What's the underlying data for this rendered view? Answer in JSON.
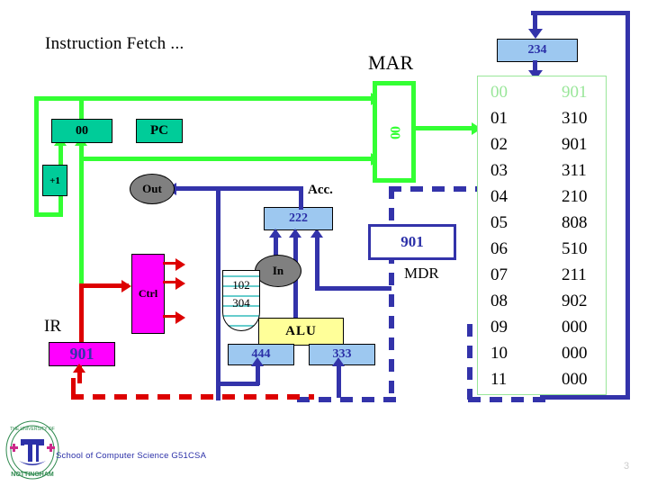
{
  "slide": {
    "title": "Instruction Fetch  ...",
    "page_number": "3",
    "footer": "School of Computer Science G51CSA",
    "logo_name": "university-of-nottingham-crest"
  },
  "colors": {
    "address_bus_green": "#33ff33",
    "register_green": "#00cc99",
    "data_bus_blue": "#3333aa",
    "data_box_blue": "#9dc8f0",
    "control_magenta": "#ff00ff",
    "control_red": "#dd0000",
    "alu_yellow": "#ffff99",
    "memory_highlight_green": "#99e699",
    "io_gray": "#808080"
  },
  "cpu": {
    "pc": {
      "label": "PC",
      "value": "00"
    },
    "incrementer": {
      "label": "+1"
    },
    "mar": {
      "label": "MAR",
      "value": "00"
    },
    "mdr": {
      "label": "MDR",
      "value": "901"
    },
    "accumulator": {
      "label": "Acc.",
      "value": "222"
    },
    "ir": {
      "label": "IR",
      "value": "901"
    },
    "control_unit": {
      "label": "Ctrl"
    },
    "alu": {
      "label": "ALU",
      "left_value": "444",
      "right_value": "333"
    },
    "bus_value": "234"
  },
  "io": {
    "out": {
      "label": "Out"
    },
    "in": {
      "label": "In"
    },
    "input_paper": {
      "lines": [
        "102",
        "304"
      ]
    }
  },
  "memory": {
    "rows": [
      {
        "address": "00",
        "value": "901",
        "highlighted": true
      },
      {
        "address": "01",
        "value": "310",
        "highlighted": false
      },
      {
        "address": "02",
        "value": "901",
        "highlighted": false
      },
      {
        "address": "03",
        "value": "311",
        "highlighted": false
      },
      {
        "address": "04",
        "value": "210",
        "highlighted": false
      },
      {
        "address": "05",
        "value": "808",
        "highlighted": false
      },
      {
        "address": "06",
        "value": "510",
        "highlighted": false
      },
      {
        "address": "07",
        "value": "211",
        "highlighted": false
      },
      {
        "address": "08",
        "value": "902",
        "highlighted": false
      },
      {
        "address": "09",
        "value": "000",
        "highlighted": false
      },
      {
        "address": "10",
        "value": "000",
        "highlighted": false
      },
      {
        "address": "11",
        "value": "000",
        "highlighted": false
      }
    ]
  }
}
